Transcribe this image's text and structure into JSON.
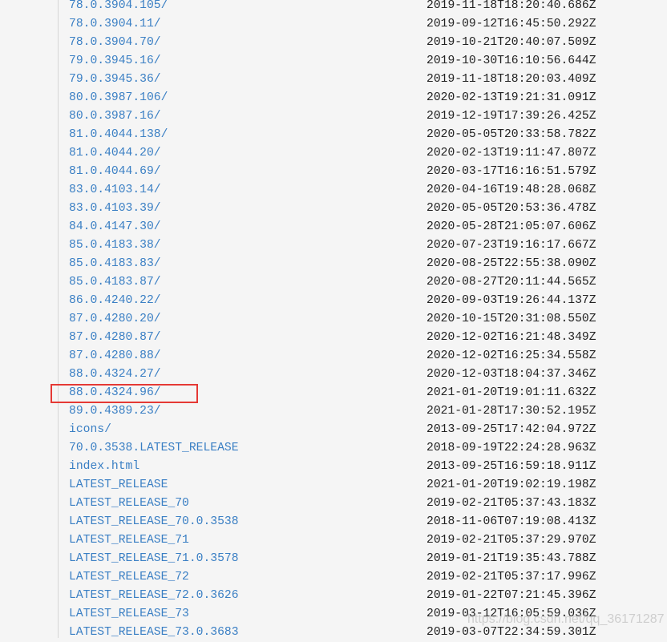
{
  "listing": [
    {
      "name": "78.0.3904.105/",
      "modified": "2019-11-18T18:20:40.686Z"
    },
    {
      "name": "78.0.3904.11/",
      "modified": "2019-09-12T16:45:50.292Z"
    },
    {
      "name": "78.0.3904.70/",
      "modified": "2019-10-21T20:40:07.509Z"
    },
    {
      "name": "79.0.3945.16/",
      "modified": "2019-10-30T16:10:56.644Z"
    },
    {
      "name": "79.0.3945.36/",
      "modified": "2019-11-18T18:20:03.409Z"
    },
    {
      "name": "80.0.3987.106/",
      "modified": "2020-02-13T19:21:31.091Z"
    },
    {
      "name": "80.0.3987.16/",
      "modified": "2019-12-19T17:39:26.425Z"
    },
    {
      "name": "81.0.4044.138/",
      "modified": "2020-05-05T20:33:58.782Z"
    },
    {
      "name": "81.0.4044.20/",
      "modified": "2020-02-13T19:11:47.807Z"
    },
    {
      "name": "81.0.4044.69/",
      "modified": "2020-03-17T16:16:51.579Z"
    },
    {
      "name": "83.0.4103.14/",
      "modified": "2020-04-16T19:48:28.068Z"
    },
    {
      "name": "83.0.4103.39/",
      "modified": "2020-05-05T20:53:36.478Z"
    },
    {
      "name": "84.0.4147.30/",
      "modified": "2020-05-28T21:05:07.606Z"
    },
    {
      "name": "85.0.4183.38/",
      "modified": "2020-07-23T19:16:17.667Z"
    },
    {
      "name": "85.0.4183.83/",
      "modified": "2020-08-25T22:55:38.090Z"
    },
    {
      "name": "85.0.4183.87/",
      "modified": "2020-08-27T20:11:44.565Z"
    },
    {
      "name": "86.0.4240.22/",
      "modified": "2020-09-03T19:26:44.137Z"
    },
    {
      "name": "87.0.4280.20/",
      "modified": "2020-10-15T20:31:08.550Z"
    },
    {
      "name": "87.0.4280.87/",
      "modified": "2020-12-02T16:21:48.349Z"
    },
    {
      "name": "87.0.4280.88/",
      "modified": "2020-12-02T16:25:34.558Z"
    },
    {
      "name": "88.0.4324.27/",
      "modified": "2020-12-03T18:04:37.346Z"
    },
    {
      "name": "88.0.4324.96/",
      "modified": "2021-01-20T19:01:11.632Z",
      "highlighted": true
    },
    {
      "name": "89.0.4389.23/",
      "modified": "2021-01-28T17:30:52.195Z"
    },
    {
      "name": "icons/",
      "modified": "2013-09-25T17:42:04.972Z"
    },
    {
      "name": "70.0.3538.LATEST_RELEASE",
      "modified": "2018-09-19T22:24:28.963Z"
    },
    {
      "name": "index.html",
      "modified": "2013-09-25T16:59:18.911Z"
    },
    {
      "name": "LATEST_RELEASE",
      "modified": "2021-01-20T19:02:19.198Z"
    },
    {
      "name": "LATEST_RELEASE_70",
      "modified": "2019-02-21T05:37:43.183Z"
    },
    {
      "name": "LATEST_RELEASE_70.0.3538",
      "modified": "2018-11-06T07:19:08.413Z"
    },
    {
      "name": "LATEST_RELEASE_71",
      "modified": "2019-02-21T05:37:29.970Z"
    },
    {
      "name": "LATEST_RELEASE_71.0.3578",
      "modified": "2019-01-21T19:35:43.788Z"
    },
    {
      "name": "LATEST_RELEASE_72",
      "modified": "2019-02-21T05:37:17.996Z"
    },
    {
      "name": "LATEST_RELEASE_72.0.3626",
      "modified": "2019-01-22T07:21:45.396Z"
    },
    {
      "name": "LATEST_RELEASE_73",
      "modified": "2019-03-12T16:05:59.036Z"
    },
    {
      "name": "LATEST_RELEASE_73.0.3683",
      "modified": "2019-03-07T22:34:59.301Z"
    }
  ],
  "colors": {
    "link": "#3a7fc4",
    "highlight_box": "#e53935"
  },
  "watermark": "https://blog.csdn.net/qq_36171287"
}
